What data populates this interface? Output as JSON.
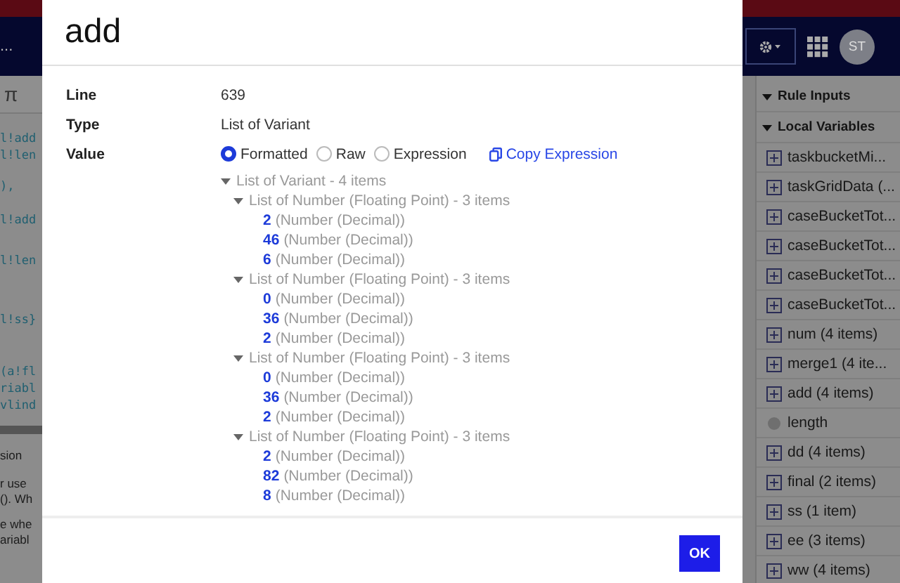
{
  "background_left": {
    "header_text": "...",
    "toolbar_symbol": "π",
    "code_lines": [
      "l!add",
      "l!len",
      "),",
      "l!add",
      "l!len",
      "l!ss}",
      "(a!fl",
      "riabl",
      "vlind"
    ],
    "help_lines": [
      "sion",
      "r use",
      "(). Wh",
      "e whe",
      "ariabl"
    ]
  },
  "background_right": {
    "avatar": "ST",
    "sections": [
      {
        "title": "Rule Inputs",
        "expanded": true
      },
      {
        "title": "Local Variables",
        "expanded": true
      }
    ],
    "variables": [
      {
        "label": "taskbucketMi...",
        "kind": "list"
      },
      {
        "label": "taskGridData (...",
        "kind": "list"
      },
      {
        "label": "caseBucketTot...",
        "kind": "list"
      },
      {
        "label": "caseBucketTot...",
        "kind": "list"
      },
      {
        "label": "caseBucketTot...",
        "kind": "list"
      },
      {
        "label": "caseBucketTot...",
        "kind": "list"
      },
      {
        "label": "num (4 items)",
        "kind": "list"
      },
      {
        "label": "merge1 (4 ite...",
        "kind": "list"
      },
      {
        "label": "add (4 items)",
        "kind": "list"
      },
      {
        "label": "length",
        "kind": "scalar"
      },
      {
        "label": "dd (4 items)",
        "kind": "list"
      },
      {
        "label": "final (2 items)",
        "kind": "list"
      },
      {
        "label": "ss (1 item)",
        "kind": "list"
      },
      {
        "label": "ee (3 items)",
        "kind": "list"
      },
      {
        "label": "ww (4 items)",
        "kind": "list"
      }
    ]
  },
  "dialog": {
    "title": "add",
    "fields": [
      {
        "label": "Line",
        "value": "639"
      },
      {
        "label": "Type",
        "value": "List of Variant"
      }
    ],
    "value_label": "Value",
    "modes": [
      {
        "label": "Formatted",
        "selected": true
      },
      {
        "label": "Raw",
        "selected": false
      },
      {
        "label": "Expression",
        "selected": false
      }
    ],
    "copy_link": "Copy Expression",
    "tree": {
      "label": "List of Variant - 4 items",
      "expanded": true,
      "children": [
        {
          "label": "List of Number (Floating Point) - 3 items",
          "expanded": true,
          "children": [
            {
              "value": "2",
              "type": "(Number (Decimal))"
            },
            {
              "value": "46",
              "type": "(Number (Decimal))"
            },
            {
              "value": "6",
              "type": "(Number (Decimal))"
            }
          ]
        },
        {
          "label": "List of Number (Floating Point) - 3 items",
          "expanded": true,
          "children": [
            {
              "value": "0",
              "type": "(Number (Decimal))"
            },
            {
              "value": "36",
              "type": "(Number (Decimal))"
            },
            {
              "value": "2",
              "type": "(Number (Decimal))"
            }
          ]
        },
        {
          "label": "List of Number (Floating Point) - 3 items",
          "expanded": true,
          "children": [
            {
              "value": "0",
              "type": "(Number (Decimal))"
            },
            {
              "value": "36",
              "type": "(Number (Decimal))"
            },
            {
              "value": "2",
              "type": "(Number (Decimal))"
            }
          ]
        },
        {
          "label": "List of Number (Floating Point) - 3 items",
          "expanded": true,
          "children": [
            {
              "value": "2",
              "type": "(Number (Decimal))"
            },
            {
              "value": "82",
              "type": "(Number (Decimal))"
            },
            {
              "value": "8",
              "type": "(Number (Decimal))"
            }
          ]
        }
      ]
    },
    "ok_button": "OK"
  }
}
